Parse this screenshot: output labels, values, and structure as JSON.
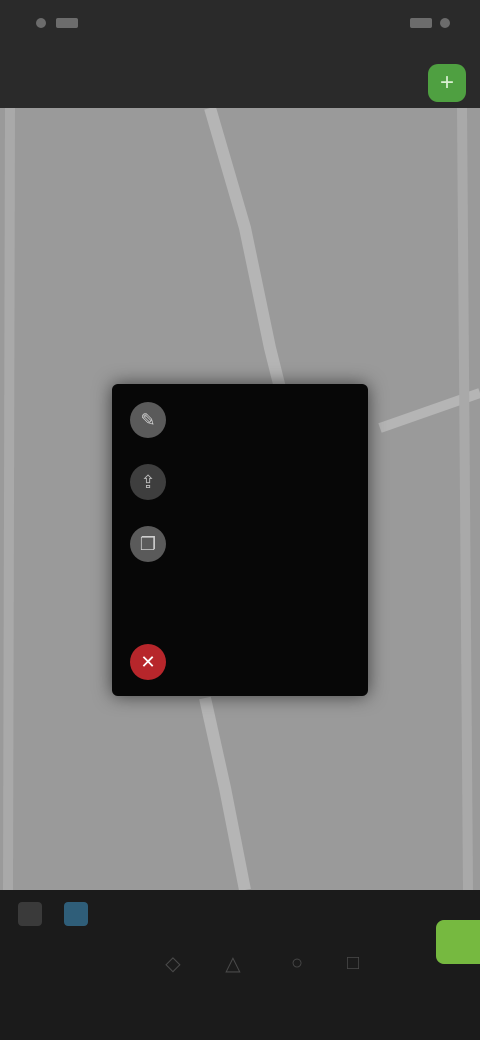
{
  "status_bar": {
    "left_icons": [
      "record-icon",
      "signal-icon"
    ],
    "right_text": "",
    "right_icons": [
      "wifi-icon",
      "battery-icon"
    ]
  },
  "header": {
    "title": "",
    "action_icon": "add-icon"
  },
  "map": {
    "background_color": "#9a9a9a",
    "road_color": "#b5b5b5"
  },
  "context_menu": {
    "items": [
      {
        "icon": "edit-icon",
        "label": ""
      },
      {
        "icon": "share-icon",
        "label": ""
      },
      {
        "icon": "copy-icon",
        "label": ""
      },
      {
        "icon": "",
        "label": ""
      },
      {
        "icon": "delete-icon",
        "label": ""
      }
    ],
    "danger_color": "#b7262b"
  },
  "bottom_bar": {
    "tools": [
      "tool-a-icon",
      "tool-b-icon",
      "tool-c-icon",
      "tool-d-icon"
    ],
    "label": "",
    "accent_color": "#76b940"
  }
}
